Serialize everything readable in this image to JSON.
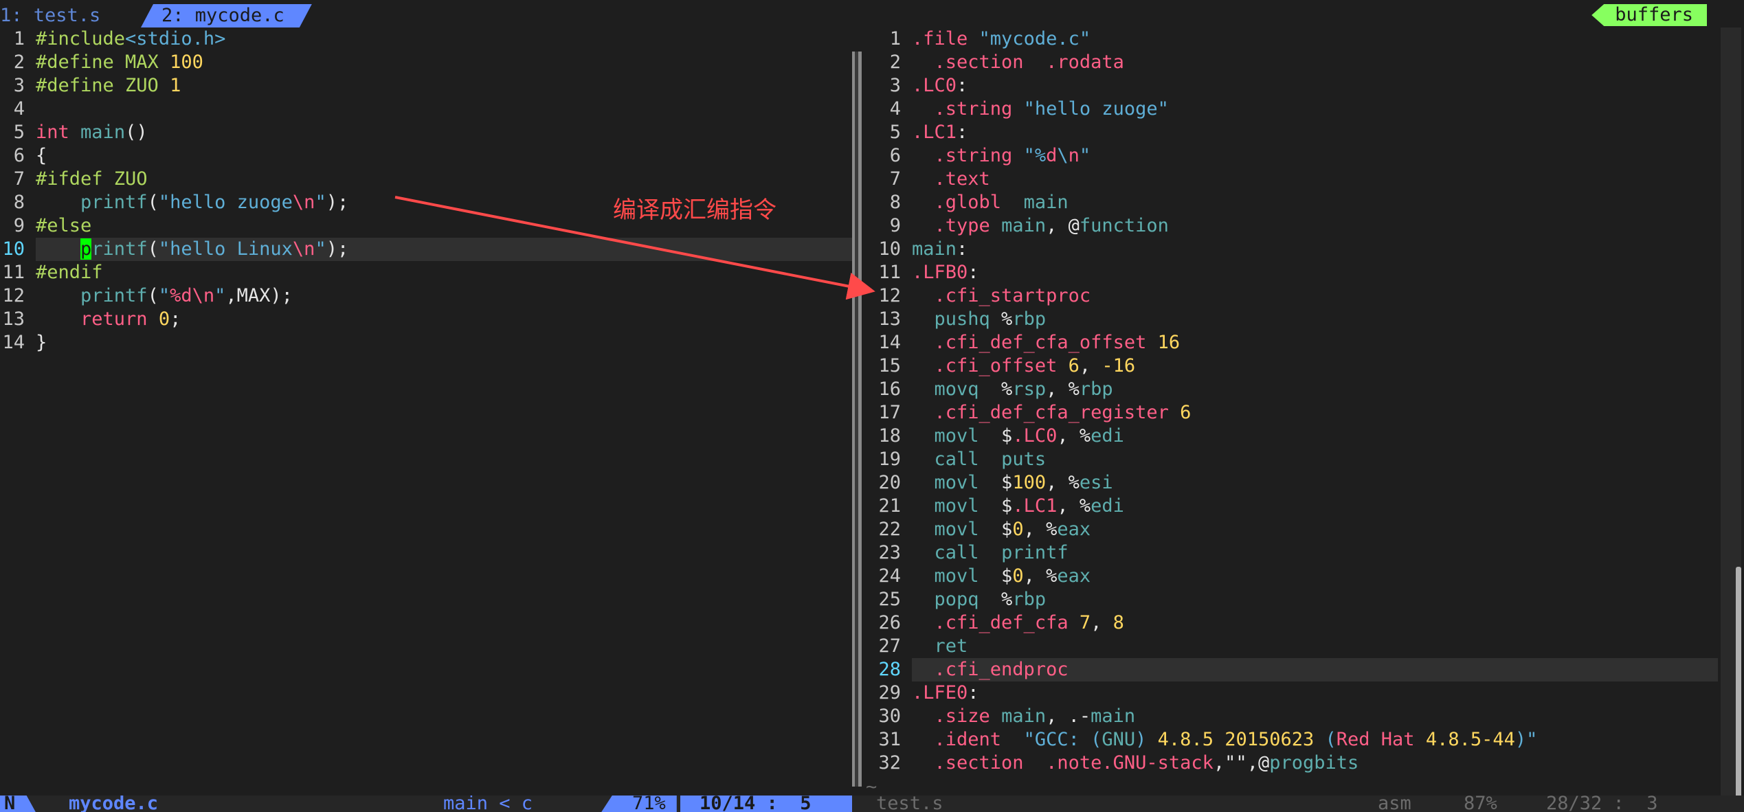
{
  "tabs": [
    {
      "label": "1: test.s"
    },
    {
      "label": "2: mycode.c"
    }
  ],
  "buffers_label": "buffers",
  "annotation": "编译成汇编指令",
  "left": {
    "current_line": 10,
    "lines": [
      {
        "n": "1",
        "t": [
          [
            "pp",
            "#include"
          ],
          [
            "inc",
            "<stdio.h>"
          ]
        ]
      },
      {
        "n": "2",
        "t": [
          [
            "pp",
            "#define MAX "
          ],
          [
            "num",
            "100"
          ]
        ]
      },
      {
        "n": "3",
        "t": [
          [
            "pp",
            "#define ZUO "
          ],
          [
            "num",
            "1"
          ]
        ]
      },
      {
        "n": "4",
        "t": []
      },
      {
        "n": "5",
        "t": [
          [
            "kw",
            "int"
          ],
          [
            "plain",
            " "
          ],
          [
            "fn",
            "main"
          ],
          [
            "plain",
            "()"
          ]
        ]
      },
      {
        "n": "6",
        "t": [
          [
            "plain",
            "{"
          ]
        ]
      },
      {
        "n": "7",
        "t": [
          [
            "pp",
            "#ifdef ZUO"
          ]
        ]
      },
      {
        "n": "8",
        "t": [
          [
            "plain",
            "    "
          ],
          [
            "fn",
            "printf"
          ],
          [
            "plain",
            "("
          ],
          [
            "str",
            "\"hello zuoge"
          ],
          [
            "esc",
            "\\n"
          ],
          [
            "str",
            "\""
          ],
          [
            "plain",
            ");"
          ]
        ]
      },
      {
        "n": "9",
        "t": [
          [
            "pp",
            "#else"
          ]
        ]
      },
      {
        "n": "10",
        "t": [
          [
            "plain",
            "    "
          ],
          [
            "cursor",
            "p"
          ],
          [
            "fn",
            "rintf"
          ],
          [
            "plain",
            "("
          ],
          [
            "str",
            "\"hello Linux"
          ],
          [
            "esc",
            "\\n"
          ],
          [
            "str",
            "\""
          ],
          [
            "plain",
            ");"
          ]
        ]
      },
      {
        "n": "11",
        "t": [
          [
            "pp",
            "#endif"
          ]
        ]
      },
      {
        "n": "12",
        "t": [
          [
            "plain",
            "    "
          ],
          [
            "fn",
            "printf"
          ],
          [
            "plain",
            "("
          ],
          [
            "str",
            "\""
          ],
          [
            "esc",
            "%d\\n"
          ],
          [
            "str",
            "\""
          ],
          [
            "plain",
            ",MAX);"
          ]
        ]
      },
      {
        "n": "13",
        "t": [
          [
            "plain",
            "    "
          ],
          [
            "kw",
            "return"
          ],
          [
            "plain",
            " "
          ],
          [
            "num",
            "0"
          ],
          [
            "plain",
            ";"
          ]
        ]
      },
      {
        "n": "14",
        "t": [
          [
            "plain",
            "}"
          ]
        ]
      }
    ]
  },
  "right": {
    "current_line": 28,
    "lines": [
      {
        "n": "1",
        "t": [
          [
            "dir",
            ".file"
          ],
          [
            "plain",
            " "
          ],
          [
            "str",
            "\"mycode.c\""
          ]
        ]
      },
      {
        "n": "2",
        "t": [
          [
            "plain",
            "  "
          ],
          [
            "dir",
            ".section"
          ],
          [
            "plain",
            "  "
          ],
          [
            "dir",
            ".rodata"
          ]
        ]
      },
      {
        "n": "3",
        "t": [
          [
            "lbl",
            ".LC0"
          ],
          [
            "plain",
            ":"
          ]
        ]
      },
      {
        "n": "4",
        "t": [
          [
            "plain",
            "  "
          ],
          [
            "dir",
            ".string"
          ],
          [
            "plain",
            " "
          ],
          [
            "str",
            "\"hello zuoge\""
          ]
        ]
      },
      {
        "n": "5",
        "t": [
          [
            "lbl",
            ".LC1"
          ],
          [
            "plain",
            ":"
          ]
        ]
      },
      {
        "n": "6",
        "t": [
          [
            "plain",
            "  "
          ],
          [
            "dir",
            ".string"
          ],
          [
            "plain",
            " "
          ],
          [
            "str",
            "\"%"
          ],
          [
            "esc",
            "d"
          ],
          [
            "str",
            "\\"
          ],
          [
            "esc",
            "n"
          ],
          [
            "str",
            "\""
          ]
        ]
      },
      {
        "n": "7",
        "t": [
          [
            "plain",
            "  "
          ],
          [
            "dir",
            ".text"
          ]
        ]
      },
      {
        "n": "8",
        "t": [
          [
            "plain",
            "  "
          ],
          [
            "dir",
            ".globl"
          ],
          [
            "plain",
            "  "
          ],
          [
            "ins",
            "main"
          ]
        ]
      },
      {
        "n": "9",
        "t": [
          [
            "plain",
            "  "
          ],
          [
            "dir",
            ".type"
          ],
          [
            "plain",
            " "
          ],
          [
            "ins",
            "main"
          ],
          [
            "plain",
            ", @"
          ],
          [
            "ins",
            "function"
          ]
        ]
      },
      {
        "n": "10",
        "t": [
          [
            "ins",
            "main"
          ],
          [
            "plain",
            ":"
          ]
        ]
      },
      {
        "n": "11",
        "t": [
          [
            "lbl",
            ".LFB0"
          ],
          [
            "plain",
            ":"
          ]
        ]
      },
      {
        "n": "12",
        "t": [
          [
            "plain",
            "  "
          ],
          [
            "dir",
            ".cfi_startproc"
          ]
        ]
      },
      {
        "n": "13",
        "t": [
          [
            "plain",
            "  "
          ],
          [
            "ins",
            "pushq"
          ],
          [
            "plain",
            " %"
          ],
          [
            "reg",
            "rbp"
          ]
        ]
      },
      {
        "n": "14",
        "t": [
          [
            "plain",
            "  "
          ],
          [
            "dir",
            ".cfi_def_cfa_offset"
          ],
          [
            "plain",
            " "
          ],
          [
            "num",
            "16"
          ]
        ]
      },
      {
        "n": "15",
        "t": [
          [
            "plain",
            "  "
          ],
          [
            "dir",
            ".cfi_offset"
          ],
          [
            "plain",
            " "
          ],
          [
            "num",
            "6"
          ],
          [
            "plain",
            ", "
          ],
          [
            "num",
            "-16"
          ]
        ]
      },
      {
        "n": "16",
        "t": [
          [
            "plain",
            "  "
          ],
          [
            "ins",
            "movq"
          ],
          [
            "plain",
            "  %"
          ],
          [
            "reg",
            "rsp"
          ],
          [
            "plain",
            ", %"
          ],
          [
            "reg",
            "rbp"
          ]
        ]
      },
      {
        "n": "17",
        "t": [
          [
            "plain",
            "  "
          ],
          [
            "dir",
            ".cfi_def_cfa_register"
          ],
          [
            "plain",
            " "
          ],
          [
            "num",
            "6"
          ]
        ]
      },
      {
        "n": "18",
        "t": [
          [
            "plain",
            "  "
          ],
          [
            "ins",
            "movl"
          ],
          [
            "plain",
            "  $"
          ],
          [
            "lbl",
            ".LC0"
          ],
          [
            "plain",
            ", %"
          ],
          [
            "reg",
            "edi"
          ]
        ]
      },
      {
        "n": "19",
        "t": [
          [
            "plain",
            "  "
          ],
          [
            "ins",
            "call"
          ],
          [
            "plain",
            "  "
          ],
          [
            "ins",
            "puts"
          ]
        ]
      },
      {
        "n": "20",
        "t": [
          [
            "plain",
            "  "
          ],
          [
            "ins",
            "movl"
          ],
          [
            "plain",
            "  $"
          ],
          [
            "num",
            "100"
          ],
          [
            "plain",
            ", %"
          ],
          [
            "reg",
            "esi"
          ]
        ]
      },
      {
        "n": "21",
        "t": [
          [
            "plain",
            "  "
          ],
          [
            "ins",
            "movl"
          ],
          [
            "plain",
            "  $"
          ],
          [
            "lbl",
            ".LC1"
          ],
          [
            "plain",
            ", %"
          ],
          [
            "reg",
            "edi"
          ]
        ]
      },
      {
        "n": "22",
        "t": [
          [
            "plain",
            "  "
          ],
          [
            "ins",
            "movl"
          ],
          [
            "plain",
            "  $"
          ],
          [
            "num",
            "0"
          ],
          [
            "plain",
            ", %"
          ],
          [
            "reg",
            "eax"
          ]
        ]
      },
      {
        "n": "23",
        "t": [
          [
            "plain",
            "  "
          ],
          [
            "ins",
            "call"
          ],
          [
            "plain",
            "  "
          ],
          [
            "ins",
            "printf"
          ]
        ]
      },
      {
        "n": "24",
        "t": [
          [
            "plain",
            "  "
          ],
          [
            "ins",
            "movl"
          ],
          [
            "plain",
            "  $"
          ],
          [
            "num",
            "0"
          ],
          [
            "plain",
            ", %"
          ],
          [
            "reg",
            "eax"
          ]
        ]
      },
      {
        "n": "25",
        "t": [
          [
            "plain",
            "  "
          ],
          [
            "ins",
            "popq"
          ],
          [
            "plain",
            "  %"
          ],
          [
            "reg",
            "rbp"
          ]
        ]
      },
      {
        "n": "26",
        "t": [
          [
            "plain",
            "  "
          ],
          [
            "dir",
            ".cfi_def_cfa"
          ],
          [
            "plain",
            " "
          ],
          [
            "num",
            "7"
          ],
          [
            "plain",
            ", "
          ],
          [
            "num",
            "8"
          ]
        ]
      },
      {
        "n": "27",
        "t": [
          [
            "plain",
            "  "
          ],
          [
            "ins",
            "ret"
          ]
        ]
      },
      {
        "n": "28",
        "t": [
          [
            "plain",
            "  "
          ],
          [
            "dir",
            ".cfi_endproc"
          ]
        ]
      },
      {
        "n": "29",
        "t": [
          [
            "lbl",
            ".LFE0"
          ],
          [
            "plain",
            ":"
          ]
        ]
      },
      {
        "n": "30",
        "t": [
          [
            "plain",
            "  "
          ],
          [
            "dir",
            ".size"
          ],
          [
            "plain",
            " "
          ],
          [
            "ins",
            "main"
          ],
          [
            "plain",
            ", .-"
          ],
          [
            "ins",
            "main"
          ]
        ]
      },
      {
        "n": "31",
        "t": [
          [
            "plain",
            "  "
          ],
          [
            "dir",
            ".ident"
          ],
          [
            "plain",
            "  "
          ],
          [
            "str",
            "\"GCC: ("
          ],
          [
            "ins",
            "GNU"
          ],
          [
            "str",
            ") "
          ],
          [
            "num",
            "4.8.5 20150623"
          ],
          [
            "str",
            " ("
          ],
          [
            "lbl",
            "Red Hat"
          ],
          [
            "num",
            " 4.8.5-44"
          ],
          [
            "str",
            ")\""
          ]
        ]
      },
      {
        "n": "32",
        "t": [
          [
            "plain",
            "  "
          ],
          [
            "dir",
            ".section"
          ],
          [
            "plain",
            "  "
          ],
          [
            "dir",
            ".note.GNU-stack"
          ],
          [
            "plain",
            ",\"\",@"
          ],
          [
            "ins",
            "progbits"
          ]
        ]
      }
    ],
    "tilde": "~"
  },
  "status": {
    "mode": "N",
    "file": "mycode.c",
    "func": "main < c",
    "percent": "71%",
    "position": "10/14 :  5",
    "right_file": "test.s",
    "right_filetype": "asm",
    "right_percent": "87%",
    "right_position": "28/32 :  3"
  }
}
